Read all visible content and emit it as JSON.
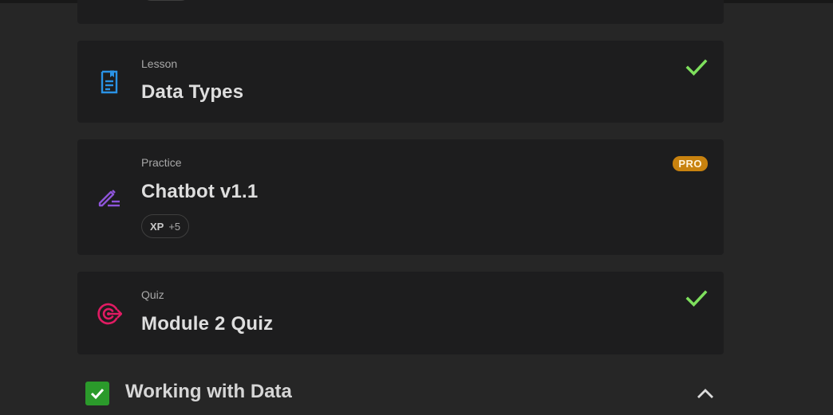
{
  "colors": {
    "background": "#262626",
    "card": "#1d1d1e",
    "check_green": "#7ee05d",
    "lesson_blue": "#2a93e6",
    "practice_purple": "#8e55d9",
    "quiz_red": "#e11b63",
    "pro_orange": "#c8820f",
    "section_green": "#2b9a2b"
  },
  "cards": [
    {
      "kind": "Lesson",
      "title": "Data Types",
      "icon": "lesson-document-icon",
      "completed": true
    },
    {
      "kind": "Practice",
      "title": "Chatbot v1.1",
      "icon": "pencil-edit-icon",
      "badge": "PRO",
      "xp_label": "XP",
      "xp_value": "+5",
      "completed": false
    },
    {
      "kind": "Quiz",
      "title": "Module 2 Quiz",
      "icon": "target-icon",
      "completed": true
    }
  ],
  "section": {
    "title": "Working with Data",
    "completed": true,
    "expanded": true
  }
}
